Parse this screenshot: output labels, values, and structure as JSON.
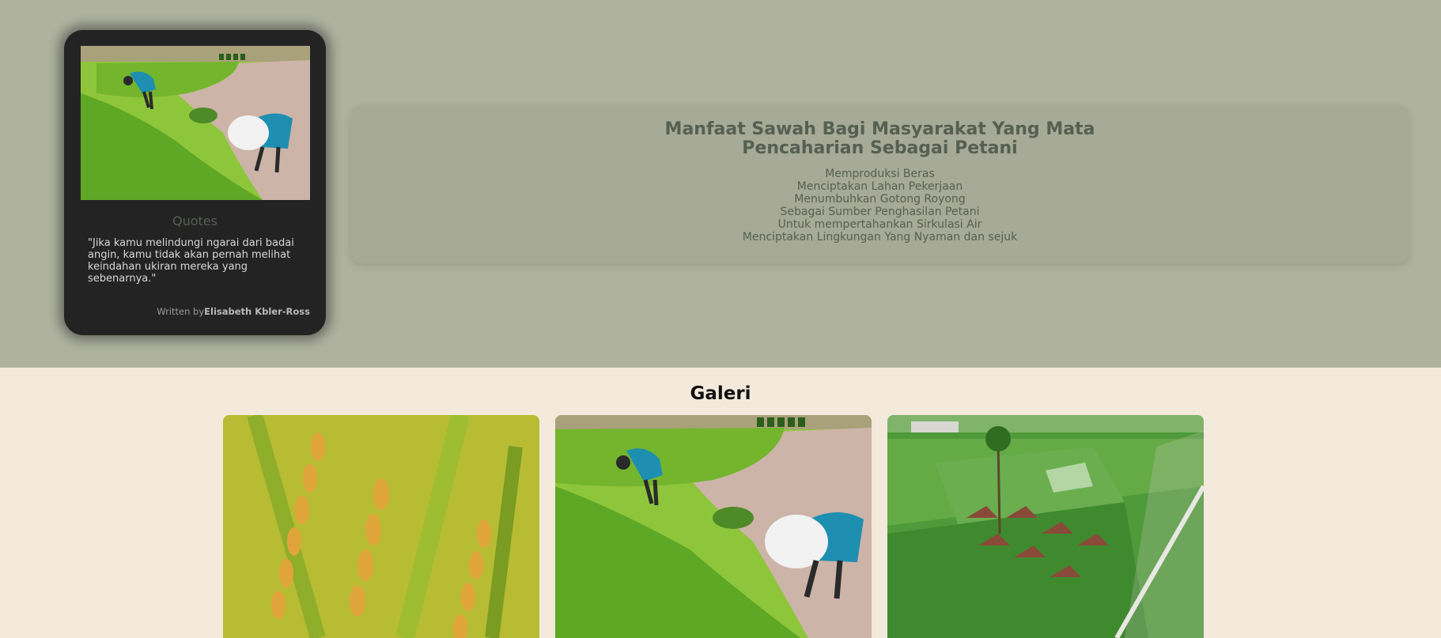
{
  "quote_card": {
    "title": "Quotes",
    "quote": "\"Jika kamu melindungi ngarai dari badai angin, kamu tidak akan pernah melihat keindahan ukiran mereka yang sebenarnya.\"",
    "written_by_prefix": "Written by",
    "author": "Elisabeth Kbler-Ross",
    "photo": "rice-planting-farmers-photo"
  },
  "info_panel": {
    "title_line1": "Manfaat Sawah Bagi Masyarakat Yang Mata",
    "title_line2": "Pencaharian Sebagai Petani",
    "benefits": [
      "Memproduksi Beras",
      "Menciptakan Lahan Pekerjaan",
      "Menumbuhkan Gotong Royong",
      "Sebagai Sumber Penghasilan Petani",
      "Untuk mempertahankan Sirkulasi Air",
      "Menciptakan Lingkungan Yang Nyaman dan sejuk"
    ]
  },
  "gallery": {
    "title": "Galeri",
    "images": [
      "golden-rice-grains-photo",
      "rice-planting-farmers-photo",
      "aerial-rice-field-gazebos-photo"
    ]
  },
  "colors": {
    "hero_bg": "#aeb29f",
    "card_bg": "#232323",
    "accent_text": "#566052",
    "gallery_bg": "#f3eadb"
  }
}
